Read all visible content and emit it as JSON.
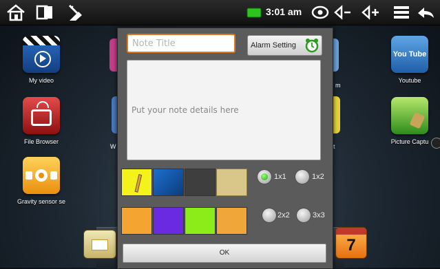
{
  "status_bar": {
    "time": "3:01 am",
    "icons": [
      "home-icon",
      "recent-apps-icon",
      "tools-icon",
      "battery-icon",
      "eye-icon",
      "volume-down-icon",
      "volume-up-icon",
      "menu-icon",
      "back-icon"
    ],
    "volume_down_label": "◁−",
    "volume_up_label": "◁+"
  },
  "desktop": {
    "apps": [
      {
        "label": "My video"
      },
      {
        "label": "File Browser"
      },
      {
        "label": "Gravity sensor se"
      },
      {
        "label": "Youtube"
      },
      {
        "label": "Picture Captu"
      }
    ],
    "youtube_logo": "You Tube",
    "calendar_day": "7",
    "partial_labels": [
      "W",
      "m",
      "t"
    ]
  },
  "note_dialog": {
    "title_placeholder": "Note Title",
    "alarm_button_label": "Alarm Setting",
    "details_placeholder": "Put your note details here",
    "size_options": [
      {
        "label": "1x1",
        "selected": true
      },
      {
        "label": "1x2",
        "selected": false
      },
      {
        "label": "2x2",
        "selected": false
      },
      {
        "label": "3x3",
        "selected": false
      }
    ],
    "ok_label": "OK"
  }
}
